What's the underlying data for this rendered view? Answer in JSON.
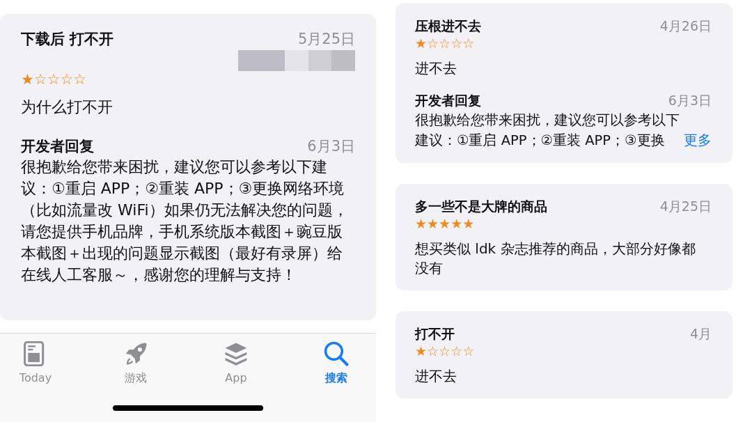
{
  "left_screen": {
    "reviews": [
      {
        "title": "下载后 打不开",
        "date": "5月25日",
        "redacted": true,
        "stars": 1,
        "body": "为什么打不开",
        "reply": {
          "label": "开发者回复",
          "date": "6月3日",
          "text": "很抱歉给您带来困扰，建议您可以参考以下建议：①重启 APP；②重装 APP；③更换网络环境（比如流量改 WiFi）如果仍无法解决您的问题，请您提供手机品牌，手机系统版本截图＋豌豆版本截图＋出现的问题显示截图（最好有录屏）给在线人工客服～，感谢您的理解与支持！"
        }
      }
    ],
    "tab_bar": {
      "tabs": [
        {
          "label": "Today",
          "selected": false
        },
        {
          "label": "游戏",
          "selected": false
        },
        {
          "label": "App",
          "selected": false
        },
        {
          "label": "搜索",
          "selected": true
        }
      ]
    }
  },
  "right_screen": {
    "reviews": [
      {
        "title": "压根进不去",
        "date": "4月26日",
        "stars": 1,
        "body": "进不去",
        "reply": {
          "label": "开发者回复",
          "date": "6月3日",
          "text": "很抱歉给您带来困扰，建议您可以参考以下建议：①重启 APP；②重装 APP；③更换",
          "more": "更多"
        }
      },
      {
        "title": "多一些不是大牌的商品",
        "date": "4月25日",
        "stars": 5,
        "body": "想买类似 ldk 杂志推荐的商品，大部分好像都没有"
      },
      {
        "title": "打不开",
        "date": "4月",
        "stars": 1,
        "body": "进不去"
      }
    ]
  }
}
